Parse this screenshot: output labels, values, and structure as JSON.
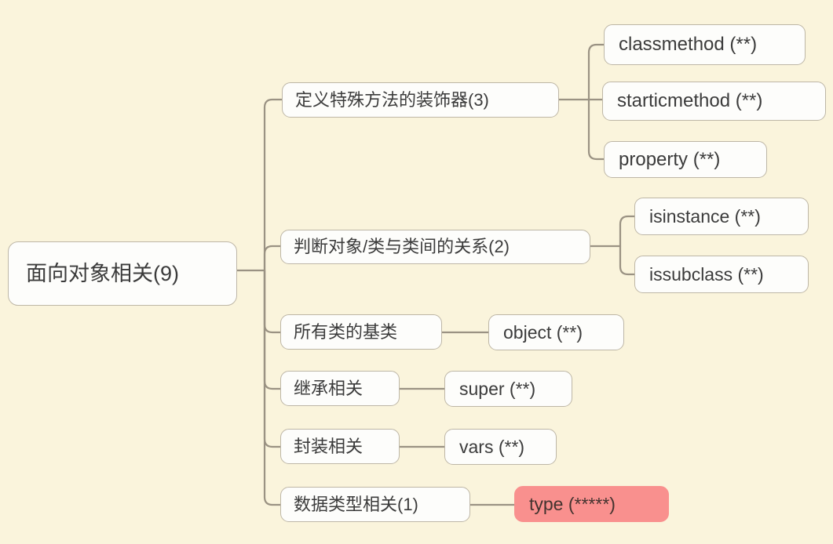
{
  "diagram": {
    "type": "mind-map",
    "title": "面向对象相关(9)",
    "background_color": "#faf4dc",
    "node_fill_color": "#fdfdfb",
    "node_border_color": "#bdb6a6",
    "connector_color": "#9a9283",
    "highlight_color": "#f9908e"
  },
  "root": {
    "label": "面向对象相关(9)"
  },
  "branches": [
    {
      "label": "定义特殊方法的装饰器(3)",
      "children": [
        {
          "label": "classmethod (**)"
        },
        {
          "label": "starticmethod (**)"
        },
        {
          "label": "property (**)"
        }
      ]
    },
    {
      "label": "判断对象/类与类间的关系(2)",
      "children": [
        {
          "label": "isinstance (**)"
        },
        {
          "label": "issubclass (**)"
        }
      ]
    },
    {
      "label": "所有类的基类",
      "children": [
        {
          "label": "object (**)"
        }
      ]
    },
    {
      "label": "继承相关",
      "children": [
        {
          "label": "super (**)"
        }
      ]
    },
    {
      "label": "封装相关",
      "children": [
        {
          "label": "vars (**)"
        }
      ]
    },
    {
      "label": "数据类型相关(1)",
      "children": [
        {
          "label": "type  (*****)",
          "highlight": true
        }
      ]
    }
  ]
}
